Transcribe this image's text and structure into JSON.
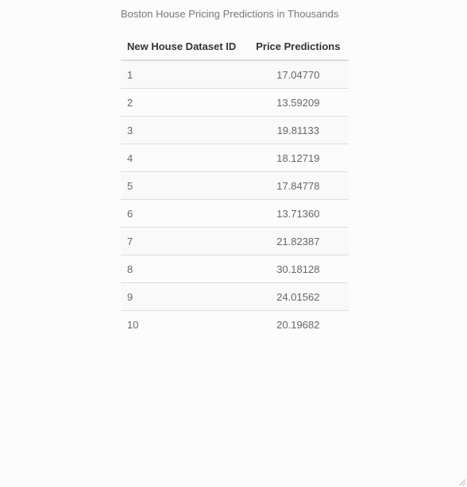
{
  "table": {
    "caption": "Boston House Pricing Predictions in Thousands",
    "headers": [
      "New House Dataset ID",
      "Price Predictions"
    ],
    "rows": [
      {
        "id": "1",
        "price": "17.04770"
      },
      {
        "id": "2",
        "price": "13.59209"
      },
      {
        "id": "3",
        "price": "19.81133"
      },
      {
        "id": "4",
        "price": "18.12719"
      },
      {
        "id": "5",
        "price": "17.84778"
      },
      {
        "id": "6",
        "price": "13.71360"
      },
      {
        "id": "7",
        "price": "21.82387"
      },
      {
        "id": "8",
        "price": "30.18128"
      },
      {
        "id": "9",
        "price": "24.01562"
      },
      {
        "id": "10",
        "price": "20.19682"
      }
    ]
  }
}
